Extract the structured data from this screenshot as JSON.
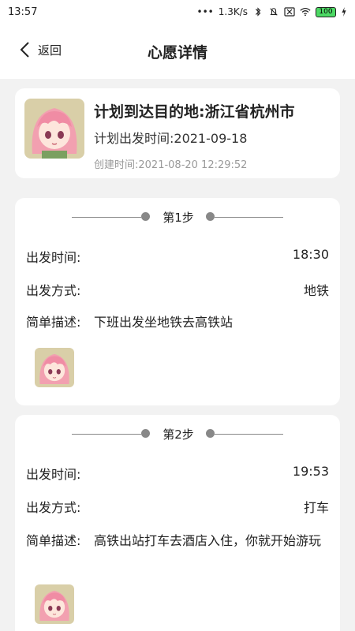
{
  "status": {
    "time": "13:57",
    "speed": "1.3K/s",
    "battery": "100"
  },
  "nav": {
    "back_label": "返回",
    "title": "心愿详情"
  },
  "summary": {
    "destination": "计划到达目的地:浙江省杭州市",
    "depart_time": "计划出发时间:2021-09-18",
    "created_time": "创建时间:2021-08-20 12:29:52"
  },
  "steps": [
    {
      "label": "第1步",
      "depart_time_label": "出发时间:",
      "depart_time": "18:30",
      "mode_label": "出发方式:",
      "mode": "地铁",
      "desc_label": "简单描述:",
      "desc": "下班出发坐地铁去高铁站"
    },
    {
      "label": "第2步",
      "depart_time_label": "出发时间:",
      "depart_time": "19:53",
      "mode_label": "出发方式:",
      "mode": "打车",
      "desc_label": "简单描述:",
      "desc": "高铁出站打车去酒店入住，你就开始游玩"
    }
  ]
}
